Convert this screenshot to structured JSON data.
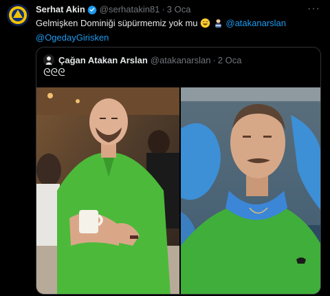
{
  "tweet": {
    "author_name": "Serhat Akin",
    "handle": "@serhatakin81",
    "separator": "·",
    "time": "3 Oca",
    "more_glyph": "···",
    "text_before": "Gelmişken Dominiği süpürmemiz yok mu ",
    "mention_1": "@atakanarslan",
    "mention_2": "@OgedayGirisken"
  },
  "quote": {
    "author_name": "Çağan Atakan Arslan",
    "handle": "@atakanarslan",
    "separator": "·",
    "time": "2 Oca",
    "text": "ᘓᘓᘓ"
  },
  "colors": {
    "background": "#000000",
    "text": "#e7e9ea",
    "muted": "#71767b",
    "link": "#1d9bf0",
    "border": "#2f3336"
  },
  "icons": [
    "avatar",
    "verified-badge-icon",
    "more-options-icon",
    "grinning-sweat-emoji",
    "person-emoji"
  ]
}
